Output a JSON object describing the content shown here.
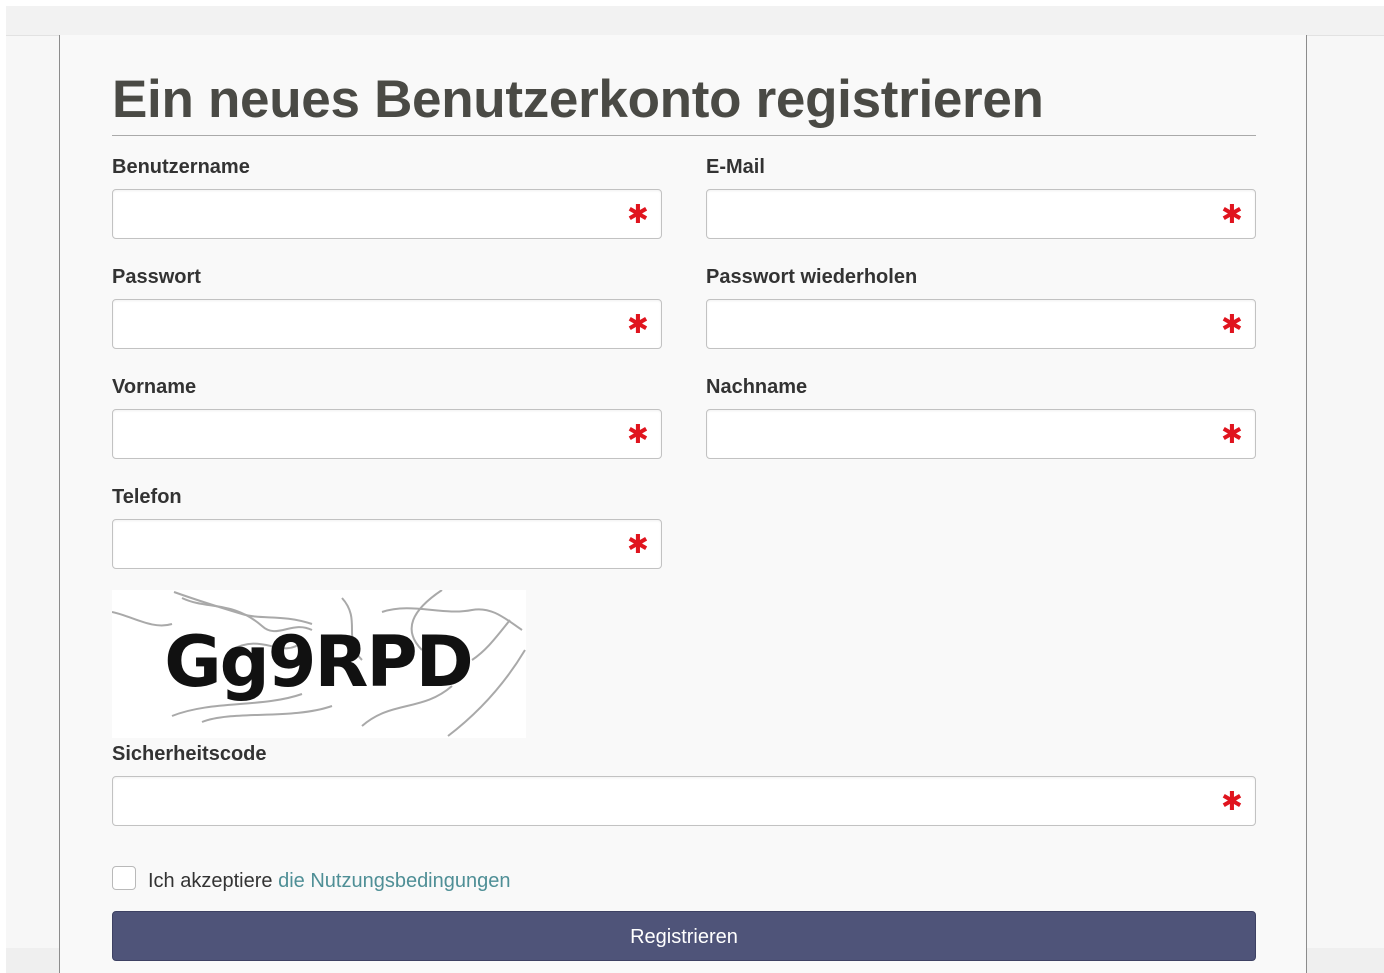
{
  "page": {
    "title": "Ein neues Benutzerkonto registrieren"
  },
  "form": {
    "required_marker": "✱",
    "fields": {
      "username": {
        "label": "Benutzername",
        "value": "",
        "placeholder": ""
      },
      "email": {
        "label": "E-Mail",
        "value": "",
        "placeholder": ""
      },
      "password": {
        "label": "Passwort",
        "value": "",
        "placeholder": ""
      },
      "password_repeat": {
        "label": "Passwort wiederholen",
        "value": "",
        "placeholder": ""
      },
      "first_name": {
        "label": "Vorname",
        "value": "",
        "placeholder": ""
      },
      "last_name": {
        "label": "Nachname",
        "value": "",
        "placeholder": ""
      },
      "phone": {
        "label": "Telefon",
        "value": "",
        "placeholder": ""
      },
      "security_code": {
        "label": "Sicherheitscode",
        "value": "",
        "placeholder": ""
      }
    },
    "captcha": {
      "text": "Gg9RPD"
    },
    "terms": {
      "prefix": "Ich akzeptiere",
      "link_text": "die Nutzungsbedingungen",
      "checked": false
    },
    "submit_label": "Registrieren"
  },
  "colors": {
    "button": "#4f5479",
    "link": "#4f8f96",
    "required": "#e0141e",
    "title": "#4a4a45"
  }
}
